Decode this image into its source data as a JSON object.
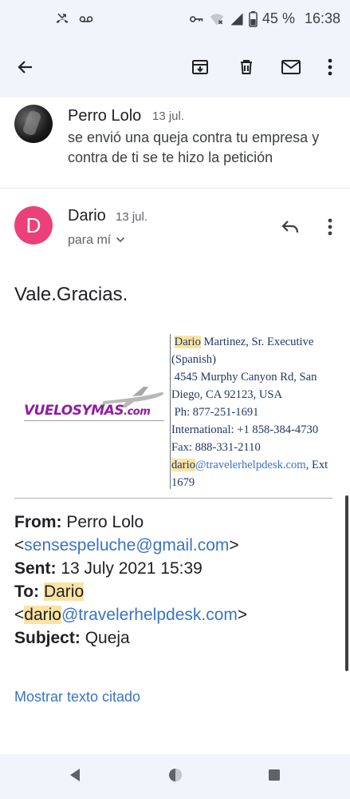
{
  "status_bar": {
    "battery": "45 %",
    "time": "16:38",
    "icons": [
      "missed-call-icon",
      "voicemail-icon",
      "vpn-key-icon",
      "wifi-off-icon",
      "signal-icon",
      "battery-icon"
    ]
  },
  "toolbar": {
    "icons": [
      "back-arrow-icon",
      "archive-icon",
      "delete-icon",
      "mark-unread-icon",
      "more-vert-icon"
    ]
  },
  "thread": {
    "previous_message": {
      "sender": "Perro Lolo",
      "date": "13 jul.",
      "snippet": "se envió una queja contra tu empresa y contra de ti se te hizo la petición"
    },
    "current_message": {
      "avatar_letter": "D",
      "sender": "Dario",
      "date": "13 jul.",
      "recipient": "para mí",
      "body": "Vale.Gracias.",
      "signature": {
        "logo_text": "vuelosymas",
        "logo_suffix": ".com",
        "name_highlight": "Dario",
        "name_rest": " Martinez, Sr. Executive (Spanish)",
        "address": "4545 Murphy Canyon Rd, San Diego, CA 92123, USA",
        "phone": "Ph: 877-251-1691",
        "international": "International: +1 858-384-4730 Fax: 888-331-2110",
        "email_highlight": "dario",
        "email_rest": "@travelerhelpdesk.com",
        "ext": ", Ext 1679"
      },
      "quoted_headers": {
        "from_label": "From:",
        "from_name": "Perro Lolo",
        "from_email": "sensespeluche@gmail.com",
        "sent_label": "Sent:",
        "sent_value": "13 July 2021 15:39",
        "to_label": "To:",
        "to_name": "Dario",
        "to_email_highlight": "dario",
        "to_email_rest": "@travelerhelpdesk.com",
        "subject_label": "Subject:",
        "subject_value": "Queja"
      },
      "show_quoted_text": "Mostrar texto citado"
    }
  },
  "colors": {
    "accent_pink": "#ec407a",
    "link_blue": "#3a73c8",
    "highlight": "#fbe3a3",
    "signature_navy": "#1f3864",
    "bar_bg": "#f1f4fa"
  }
}
